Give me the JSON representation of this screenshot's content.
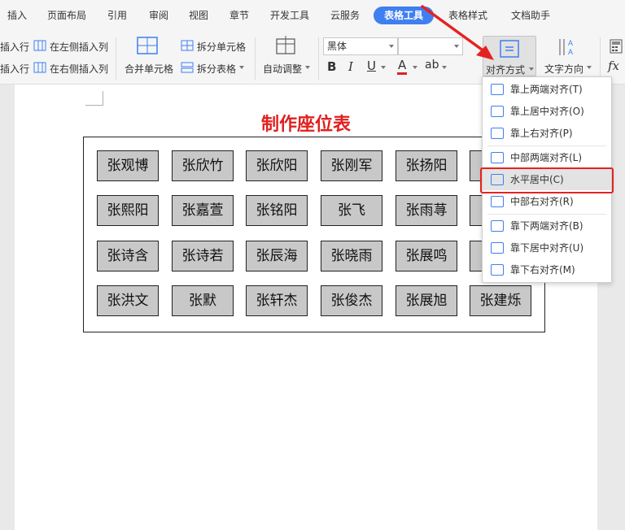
{
  "menu": {
    "tabs": [
      "插入",
      "页面布局",
      "引用",
      "审阅",
      "视图",
      "章节",
      "开发工具",
      "云服务",
      "表格工具",
      "表格样式",
      "文档助手"
    ],
    "active_tab": "表格工具"
  },
  "ribbon": {
    "insert_row_above": "插入行",
    "insert_row_below": "插入行",
    "insert_col_left": "在左侧插入列",
    "insert_col_right": "在右侧插入列",
    "merge_cells": "合并单元格",
    "split_cells": "拆分单元格",
    "split_table": "拆分表格",
    "auto_fit": "自动调整",
    "font_name": "黑体",
    "font_size": "",
    "align_mode": "对齐方式",
    "text_direction": "文字方向",
    "formula": "fx"
  },
  "document": {
    "title": "制作座位表",
    "seats": [
      [
        "张观博",
        "张欣竹",
        "张欣阳",
        "张刚军",
        "张扬阳",
        ""
      ],
      [
        "张熙阳",
        "张嘉萱",
        "张铭阳",
        "张飞",
        "张雨荨",
        ""
      ],
      [
        "张诗含",
        "张诗若",
        "张辰海",
        "张晓雨",
        "张展鸣",
        ""
      ],
      [
        "张洪文",
        "张默",
        "张轩杰",
        "张俊杰",
        "张展旭",
        "张建烁"
      ]
    ]
  },
  "align_menu": {
    "items": [
      {
        "label": "靠上两端对齐(T)"
      },
      {
        "label": "靠上居中对齐(O)"
      },
      {
        "label": "靠上右对齐(P)"
      },
      {
        "label": "中部两端对齐(L)"
      },
      {
        "label": "水平居中(C)",
        "selected": true
      },
      {
        "label": "中部右对齐(R)"
      },
      {
        "label": "靠下两端对齐(B)"
      },
      {
        "label": "靠下居中对齐(U)"
      },
      {
        "label": "靠下右对齐(M)"
      }
    ]
  },
  "colors": {
    "accent": "#3f7ff0",
    "highlight": "#e52222",
    "title": "#e02020"
  }
}
